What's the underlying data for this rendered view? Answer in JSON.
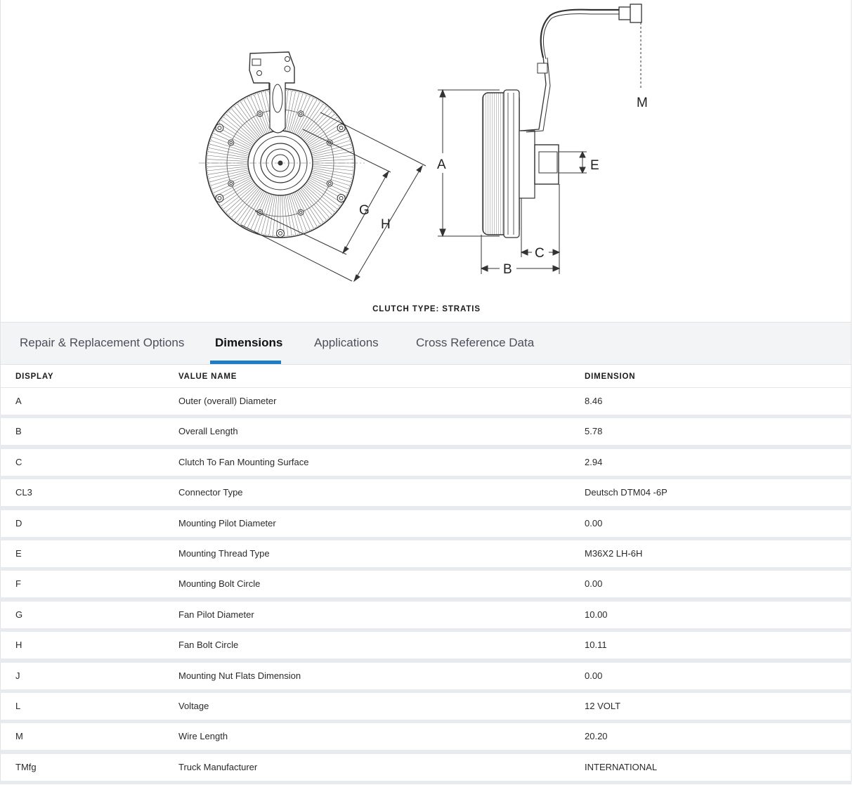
{
  "figure": {
    "caption": "CLUTCH TYPE: STRATIS",
    "labels": {
      "a": "A",
      "b": "B",
      "c": "C",
      "e": "E",
      "g": "G",
      "h": "H",
      "m": "M"
    }
  },
  "tabs": [
    {
      "label": "Repair & Replacement Options"
    },
    {
      "label": "Dimensions",
      "active": true
    },
    {
      "label": "Applications"
    },
    {
      "label": "Cross Reference Data"
    }
  ],
  "table": {
    "headers": {
      "display": "DISPLAY",
      "value_name": "VALUE NAME",
      "dimension": "DIMENSION"
    },
    "rows": [
      {
        "display": "A",
        "name": "Outer (overall) Diameter",
        "value": "8.46"
      },
      {
        "display": "B",
        "name": "Overall Length",
        "value": "5.78"
      },
      {
        "display": "C",
        "name": "Clutch To Fan Mounting Surface",
        "value": "2.94"
      },
      {
        "display": "CL3",
        "name": "Connector Type",
        "value": "Deutsch DTM04 -6P"
      },
      {
        "display": "D",
        "name": "Mounting Pilot Diameter",
        "value": "0.00"
      },
      {
        "display": "E",
        "name": "Mounting Thread Type",
        "value": "M36X2 LH-6H"
      },
      {
        "display": "F",
        "name": "Mounting Bolt Circle",
        "value": "0.00"
      },
      {
        "display": "G",
        "name": "Fan Pilot Diameter",
        "value": "10.00"
      },
      {
        "display": "H",
        "name": "Fan Bolt Circle",
        "value": "10.11"
      },
      {
        "display": "J",
        "name": "Mounting Nut Flats Dimension",
        "value": "0.00"
      },
      {
        "display": "L",
        "name": "Voltage",
        "value": "12 VOLT"
      },
      {
        "display": "M",
        "name": "Wire Length",
        "value": "20.20"
      },
      {
        "display": "TMfg",
        "name": "Truck Manufacturer",
        "value": "INTERNATIONAL"
      }
    ]
  },
  "colors": {
    "accent": "#1e7ec5",
    "tab_bar_bg": "#f3f4f6",
    "row_gap": "#e7eaef"
  }
}
